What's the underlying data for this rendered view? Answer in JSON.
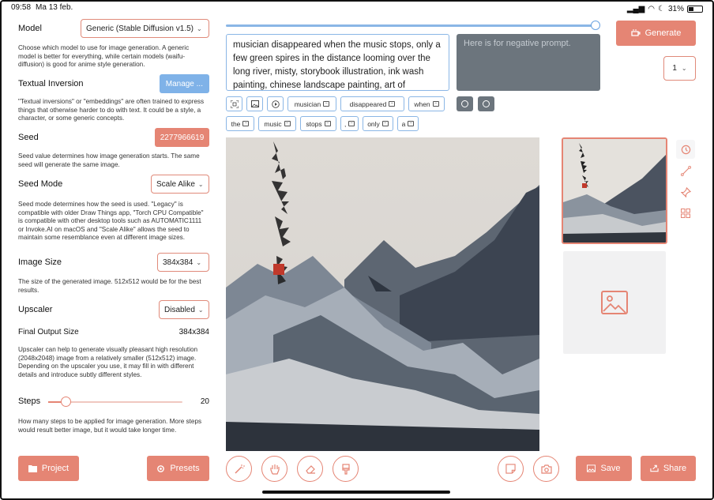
{
  "status_bar": {
    "time": "09:58",
    "date": "Ma 13 feb.",
    "battery": "31%",
    "battery_fraction": 0.31
  },
  "settings": {
    "model": {
      "label": "Model",
      "value": "Generic (Stable Diffusion v1.5)",
      "description": "Choose which model to use for image generation. A generic model is better for everything, while certain models (waifu-diffusion) is good for anime style generation."
    },
    "textual_inversion": {
      "label": "Textual Inversion",
      "button": "Manage ...",
      "description": "\"Textual inversions\" or \"embeddings\" are often trained to express things that otherwise harder to do with text. It could be a style, a character, or some generic concepts."
    },
    "seed": {
      "label": "Seed",
      "value": "2277966619",
      "description": "Seed value determines how image generation starts. The same seed will generate the same image."
    },
    "seed_mode": {
      "label": "Seed Mode",
      "value": "Scale Alike",
      "description": "Seed mode determines how the seed is used. \"Legacy\" is compatible with older Draw Things app, \"Torch CPU Compatible\" is compatible with other desktop tools such as AUTOMATIC1111 or Invoke.AI on macOS and \"Scale Alike\" allows the seed to maintain some resemblance even at different image sizes."
    },
    "image_size": {
      "label": "Image Size",
      "value": "384x384",
      "description": "The size of the generated image. 512x512 would be for the best results."
    },
    "upscaler": {
      "label": "Upscaler",
      "value": "Disabled"
    },
    "final_output": {
      "label": "Final Output Size",
      "value": "384x384",
      "description": "Upscaler can help to generate visually pleasant high resolution (2048x2048) image from a relatively smaller (512x512) image. Depending on the upscaler you use, it may fill in with different details and introduce subtly different styles."
    },
    "steps": {
      "label": "Steps",
      "value": "20",
      "fraction": 0.13,
      "description": "How many steps to be applied for image generation. More steps would result better image, but it would take longer time."
    }
  },
  "buttons": {
    "project": "Project",
    "presets": "Presets",
    "generate": "Generate",
    "save": "Save",
    "share": "Share"
  },
  "batch_count": "1",
  "prompt": {
    "text": "musician disappeared when the music stops, only a few green spires in the distance looming over the long river, misty, storybook illustration, ink wash painting, chinese landscape painting, art of",
    "negative_placeholder": "Here is for negative prompt.",
    "progress": 1.0
  },
  "tokens_row1": [
    "musician",
    "disappeared",
    "when"
  ],
  "tokens_row2": [
    "the",
    "music",
    "stops",
    ",",
    "only",
    "a"
  ]
}
